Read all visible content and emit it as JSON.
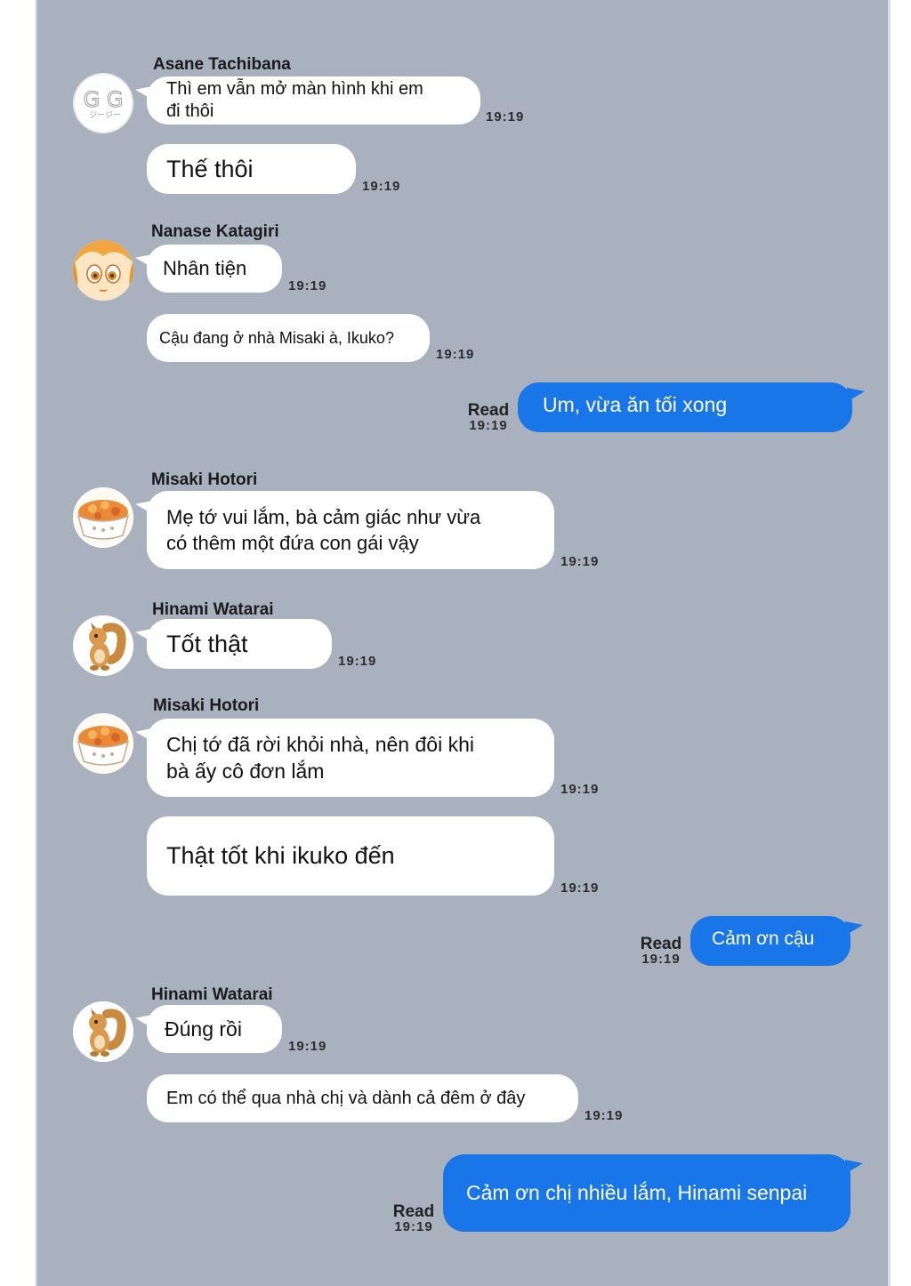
{
  "theme": {
    "background": "#a9b0be",
    "outgoing_bubble": "#1976e8",
    "incoming_bubble": "#ffffff"
  },
  "messages": [
    {
      "sender": "Asane Tachibana",
      "avatar": "gg-logo-icon",
      "bubbles": [
        {
          "text": "Thì em vẫn mở màn hình khi em\nđi thôi",
          "time": "19:19"
        },
        {
          "text": "Thế thôi",
          "time": "19:19"
        }
      ]
    },
    {
      "sender": "Nanase Katagiri",
      "avatar": "anime-girl-avatar-icon",
      "bubbles": [
        {
          "text": "Nhân tiện",
          "time": "19:19"
        },
        {
          "text": "Cậu đang ở nhà Misaki à, Ikuko?",
          "time": "19:19"
        }
      ]
    },
    {
      "outgoing": true,
      "text": "Um, vừa ăn tối xong",
      "read": "Read",
      "time": "19:19"
    },
    {
      "sender": "Misaki Hotori",
      "avatar": "food-bowl-avatar-icon",
      "bubbles": [
        {
          "text": "Mẹ tớ vui lắm, bà cảm giác như vừa\ncó thêm một đứa con gái vậy",
          "time": "19:19"
        }
      ]
    },
    {
      "sender": "Hinami Watarai",
      "avatar": "squirrel-avatar-icon",
      "bubbles": [
        {
          "text": "Tốt thật",
          "time": "19:19"
        }
      ]
    },
    {
      "sender": "Misaki Hotori",
      "avatar": "food-bowl-avatar-icon",
      "bubbles": [
        {
          "text": "Chị tớ đã rời khỏi nhà, nên đôi khi\nbà ấy cô đơn lắm",
          "time": "19:19"
        },
        {
          "text": "Thật tốt khi ikuko đến",
          "time": "19:19"
        }
      ]
    },
    {
      "outgoing": true,
      "text": "Cảm ơn cậu",
      "read": "Read",
      "time": "19:19"
    },
    {
      "sender": "Hinami Watarai",
      "avatar": "squirrel-avatar-icon",
      "bubbles": [
        {
          "text": "Đúng rồi",
          "time": "19:19"
        },
        {
          "text": "Em có thể qua nhà chị và dành cả đêm ở đây",
          "time": "19:19"
        }
      ]
    },
    {
      "outgoing": true,
      "text": "Cảm ơn chị nhiều lắm, Hinami senpai",
      "read": "Read",
      "time": "19:19"
    }
  ]
}
